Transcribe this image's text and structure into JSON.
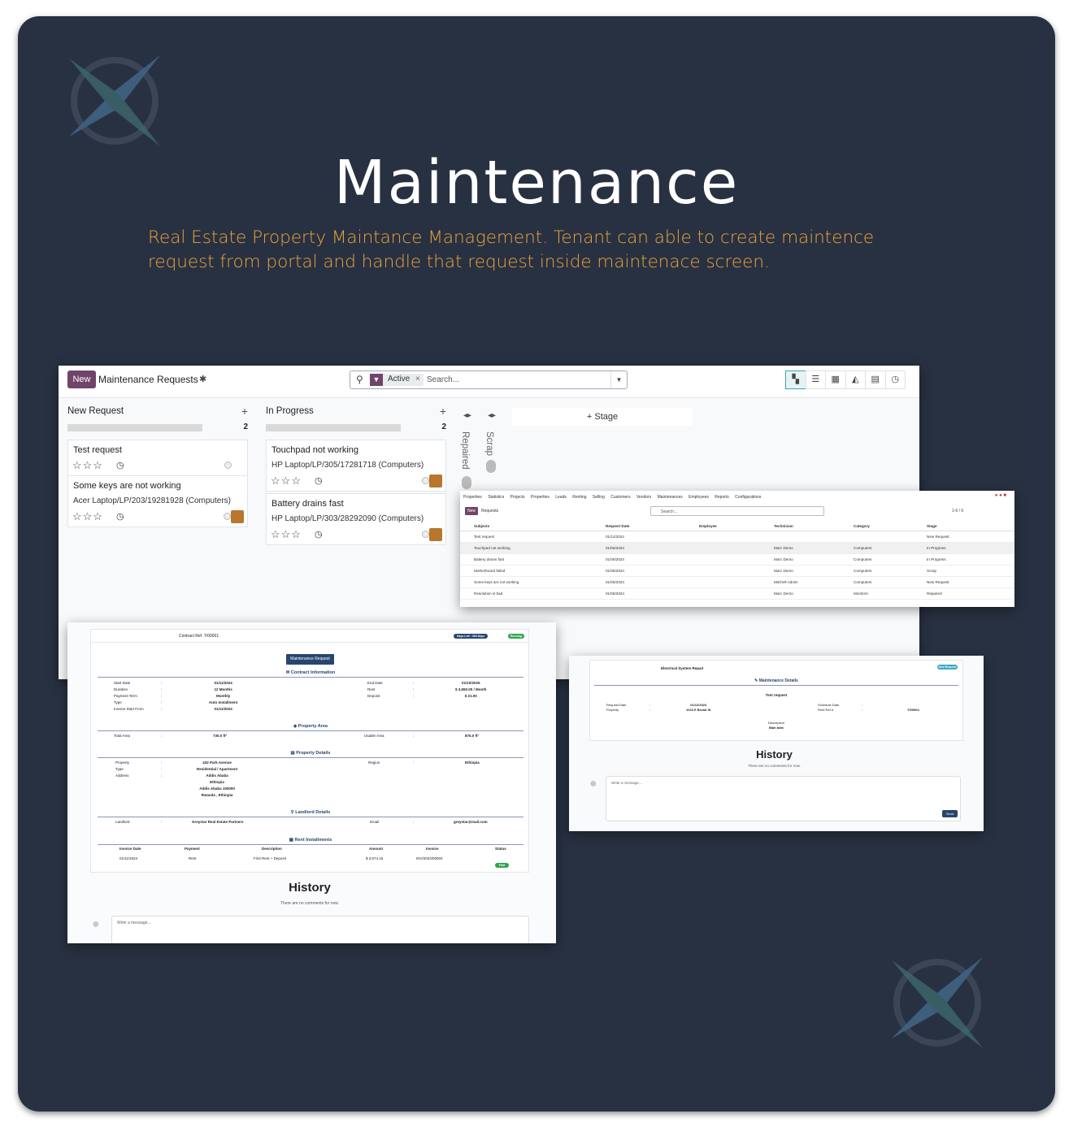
{
  "hero": {
    "title": "Maintenance",
    "subtitle": "Real Estate Property Maintance Management. Tenant can able to create maintence request from portal and handle that request inside maintenace screen."
  },
  "colors": {
    "background": "#283142",
    "accent": "#e9a43a",
    "brand": "#71446a"
  },
  "kanban": {
    "new_label": "New",
    "title": "Maintenance Requests",
    "search": {
      "facet": "Active",
      "placeholder": "Search..."
    },
    "views": [
      "kanban-icon",
      "list-icon",
      "pivot-icon",
      "graph-icon",
      "calendar-icon",
      "activity-icon"
    ],
    "columns": [
      {
        "title": "New Request",
        "count": "2",
        "cards": [
          {
            "title": "Test request",
            "subtitle": ""
          },
          {
            "title": "Some keys are not working",
            "subtitle": "Acer Laptop/LP/203/19281928 (Computers)"
          }
        ]
      },
      {
        "title": "In Progress",
        "count": "2",
        "cards": [
          {
            "title": "Touchpad not working",
            "subtitle": "HP Laptop/LP/305/17281718 (Computers)"
          },
          {
            "title": "Battery drains fast",
            "subtitle": "HP Laptop/LP/303/28292090 (Computers)"
          }
        ]
      }
    ],
    "folded": [
      {
        "title": "Repaired",
        "count": "1"
      },
      {
        "title": "Scrap",
        "count": "1"
      }
    ],
    "add_stage": "Stage"
  },
  "list_view": {
    "nav": [
      "Properties",
      "Statistics",
      "Projects",
      "Properties",
      "Leads",
      "Renting",
      "Selling",
      "Customers",
      "Vendors",
      "Maintenances",
      "Employees",
      "Reports",
      "Configurations"
    ],
    "new_label": "New",
    "breadcrumb": "Requests",
    "search_placeholder": "Search...",
    "pager": "1-6 / 6",
    "headers": [
      "Subjects",
      "Request Date",
      "Employee",
      "Technician",
      "Category",
      "Stage"
    ],
    "rows": [
      [
        "Test request",
        "01/12/2024",
        "",
        "",
        "",
        "New Request"
      ],
      [
        "Touchpad not working",
        "01/06/2024",
        "",
        "Marc Demo",
        "Computers",
        "In Progress"
      ],
      [
        "Battery drains fast",
        "01/06/2024",
        "",
        "Marc Demo",
        "Computers",
        "In Progress"
      ],
      [
        "Motherboard failed",
        "01/06/2024",
        "",
        "Marc Demo",
        "Computers",
        "Scrap"
      ],
      [
        "Some keys are not working",
        "01/06/2024",
        "",
        "Mitchell Admin",
        "Computers",
        "New Request"
      ],
      [
        "Resolution is bad",
        "01/06/2024",
        "",
        "Marc Demo",
        "Monitors",
        "Repaired"
      ]
    ]
  },
  "contract": {
    "ref": "Contract Ref. T/00001",
    "days_left": "Days Left : 354 Days",
    "status": "Running",
    "button": "Maintenance Request",
    "sections": {
      "contract": "Contract Information",
      "area": "Property Area",
      "details": "Property Details",
      "landlord": "Landlord Details",
      "installments": "Rent Installments"
    },
    "left_labels": "Start Date\nDuration\nPayment Term\nType\nInvoice Start From",
    "left_values": "01/11/2024\n12 Months\nMonthly\nAuto Installment\n01/11/2024",
    "right_labels": "End Date\nRent\nDeposit",
    "right_values": "01/10/2025\n$ 3,650.00 / Month\n$ 21.00",
    "total_area_label": "Total Area",
    "total_area": "730.0 ft²",
    "usable_area_label": "Usable Area",
    "usable_area": "875.0 ft²",
    "prop_labels": "Property\nType\nAddress",
    "prop_values": "432 Park Avenue\nResidential / Apartment\nAddis Ababa\nEthiopia\nAddis Ababa 100000\nRwanda , Ethiopia",
    "region_label": "Region",
    "region": "Ethiopia",
    "landlord_label": "Landlord",
    "landlord": "Greystar Real Estate Partners",
    "email_label": "Email",
    "email": "greystar@mail.com",
    "inst_headers": [
      "Invoice Date",
      "Payment",
      "Description",
      "Amount",
      "Invoice",
      "Status"
    ],
    "inst_row": [
      "01/11/2024",
      "Rent",
      "First Rent + Deposit",
      "$ 3,674.15",
      "INV/2024/00004",
      "Paid"
    ],
    "history": "History",
    "no_comments": "There are no comments for now.",
    "message_placeholder": "Write a message..."
  },
  "electrical": {
    "title": "Electrical System Repair",
    "badge": "New Request",
    "section": "Maintenance Details",
    "request": "Test request",
    "left_labels": "Request Date\nProperty",
    "left_values": "01/12/2024\n1023 E Broad St",
    "right_labels": "Schedule Date\nRent Ref #",
    "right_values": "\nT/00004",
    "desc_label": "Description",
    "desc": "Blah blah",
    "history": "History",
    "no_comments": "There are no comments for now.",
    "message_placeholder": "Write a message...",
    "send": "Send"
  }
}
